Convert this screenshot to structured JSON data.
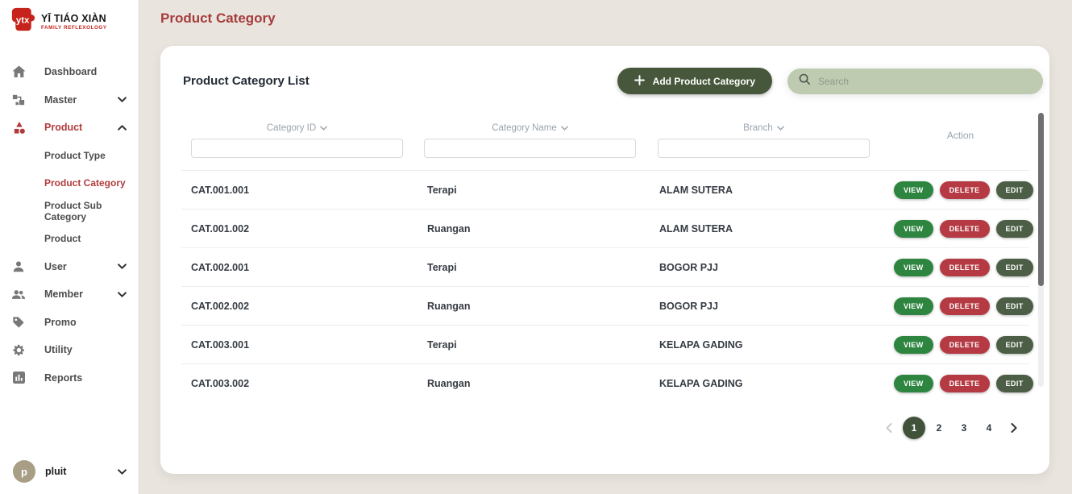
{
  "brand": {
    "title": "YĪ TIÁO XIÀN",
    "subtitle": "FAMILY REFLEXOLOGY"
  },
  "header": {
    "title": "Product Category"
  },
  "sidebar": {
    "items": [
      {
        "icon": "home-icon",
        "label": "Dashboard"
      },
      {
        "icon": "sitemap-icon",
        "label": "Master",
        "expanded": false
      },
      {
        "icon": "shapes-icon",
        "label": "Product",
        "expanded": true,
        "active": true
      },
      {
        "icon": "user-icon",
        "label": "User",
        "expanded": false
      },
      {
        "icon": "users-icon",
        "label": "Member",
        "expanded": false
      },
      {
        "icon": "tag-icon",
        "label": "Promo"
      },
      {
        "icon": "gear-icon",
        "label": "Utility"
      },
      {
        "icon": "bar-chart-icon",
        "label": "Reports"
      }
    ],
    "product_children": [
      {
        "label": "Product Type",
        "active": false
      },
      {
        "label": "Product Category",
        "active": true
      },
      {
        "label": "Product Sub Category",
        "active": false
      },
      {
        "label": "Product",
        "active": false
      }
    ],
    "user": {
      "initial": "p",
      "name": "pluit"
    }
  },
  "card": {
    "title": "Product Category List",
    "add_button_label": "Add Product Category",
    "search_placeholder": "Search"
  },
  "table": {
    "columns": [
      {
        "label": "Category ID",
        "sortable": true,
        "filter_value": ""
      },
      {
        "label": "Category Name",
        "sortable": true,
        "filter_value": ""
      },
      {
        "label": "Branch",
        "sortable": true,
        "filter_value": ""
      },
      {
        "label": "Action",
        "sortable": false
      }
    ],
    "rows": [
      {
        "category_id": "CAT.001.001",
        "category_name": "Terapi",
        "branch": "ALAM SUTERA"
      },
      {
        "category_id": "CAT.001.002",
        "category_name": "Ruangan",
        "branch": "ALAM SUTERA"
      },
      {
        "category_id": "CAT.002.001",
        "category_name": "Terapi",
        "branch": "BOGOR PJJ"
      },
      {
        "category_id": "CAT.002.002",
        "category_name": "Ruangan",
        "branch": "BOGOR PJJ"
      },
      {
        "category_id": "CAT.003.001",
        "category_name": "Terapi",
        "branch": "KELAPA GADING"
      },
      {
        "category_id": "CAT.003.002",
        "category_name": "Ruangan",
        "branch": "KELAPA GADING"
      }
    ],
    "actions": [
      {
        "label": "VIEW",
        "color": "#2e8540"
      },
      {
        "label": "DELETE",
        "color": "#b53a43"
      },
      {
        "label": "EDIT",
        "color": "#4c5f46"
      }
    ]
  },
  "pagination": {
    "pages": [
      "1",
      "2",
      "3",
      "4"
    ],
    "active_page": "1"
  },
  "colors": {
    "background": "#e9e5de",
    "header_red": "#a53c3c",
    "sidebar_active_red": "#b23b3b",
    "add_button_green": "#47573b",
    "search_pill_green": "#bfcbb1",
    "pagination_active_green": "#40523a",
    "avatar_khaki": "#a79e85"
  }
}
